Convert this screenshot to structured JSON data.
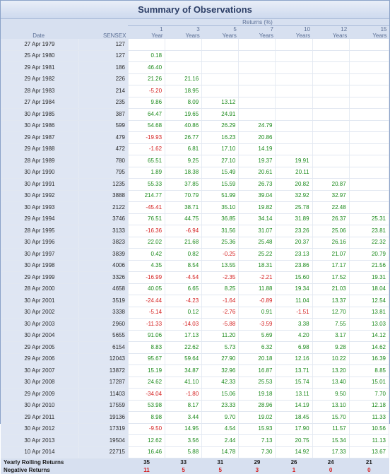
{
  "title": "Summary of Observations",
  "header": {
    "date": "Date",
    "sensex": "SENSEX",
    "returns": "Returns (%)",
    "periods": [
      {
        "n": "1",
        "unit": "Year"
      },
      {
        "n": "3",
        "unit": "Years"
      },
      {
        "n": "5",
        "unit": "Years"
      },
      {
        "n": "7",
        "unit": "Years"
      },
      {
        "n": "10",
        "unit": "Years"
      },
      {
        "n": "12",
        "unit": "Years"
      },
      {
        "n": "15",
        "unit": "Years"
      }
    ]
  },
  "colors": {
    "positive": "#1b8a1b",
    "negative": "#d41e1e"
  },
  "rows": [
    {
      "date": "27 Apr 1979",
      "sensex": "127",
      "r": [
        "",
        "",
        "",
        "",
        "",
        "",
        ""
      ]
    },
    {
      "date": "25 Apr 1980",
      "sensex": "127",
      "r": [
        "0.18",
        "",
        "",
        "",
        "",
        "",
        ""
      ]
    },
    {
      "date": "29 Apr 1981",
      "sensex": "186",
      "r": [
        "46.40",
        "",
        "",
        "",
        "",
        "",
        ""
      ]
    },
    {
      "date": "29 Apr 1982",
      "sensex": "226",
      "r": [
        "21.26",
        "21.16",
        "",
        "",
        "",
        "",
        ""
      ]
    },
    {
      "date": "28 Apr 1983",
      "sensex": "214",
      "r": [
        "-5.20",
        "18.95",
        "",
        "",
        "",
        "",
        ""
      ]
    },
    {
      "date": "27 Apr 1984",
      "sensex": "235",
      "r": [
        "9.86",
        "8.09",
        "13.12",
        "",
        "",
        "",
        ""
      ]
    },
    {
      "date": "30 Apr 1985",
      "sensex": "387",
      "r": [
        "64.47",
        "19.65",
        "24.91",
        "",
        "",
        "",
        ""
      ]
    },
    {
      "date": "30 Apr 1986",
      "sensex": "599",
      "r": [
        "54.68",
        "40.86",
        "26.29",
        "24.79",
        "",
        "",
        ""
      ]
    },
    {
      "date": "29 Apr 1987",
      "sensex": "479",
      "r": [
        "-19.93",
        "26.77",
        "16.23",
        "20.86",
        "",
        "",
        ""
      ]
    },
    {
      "date": "29 Apr 1988",
      "sensex": "472",
      "r": [
        "-1.62",
        "6.81",
        "17.10",
        "14.19",
        "",
        "",
        ""
      ]
    },
    {
      "date": "28 Apr 1989",
      "sensex": "780",
      "r": [
        "65.51",
        "9.25",
        "27.10",
        "19.37",
        "19.91",
        "",
        ""
      ]
    },
    {
      "date": "30 Apr 1990",
      "sensex": "795",
      "r": [
        "1.89",
        "18.38",
        "15.49",
        "20.61",
        "20.11",
        "",
        ""
      ]
    },
    {
      "date": "30 Apr 1991",
      "sensex": "1235",
      "r": [
        "55.33",
        "37.85",
        "15.59",
        "26.73",
        "20.82",
        "20.87",
        ""
      ]
    },
    {
      "date": "30 Apr 1992",
      "sensex": "3888",
      "r": [
        "214.77",
        "70.79",
        "51.99",
        "39.04",
        "32.92",
        "32.97",
        ""
      ]
    },
    {
      "date": "30 Apr 1993",
      "sensex": "2122",
      "r": [
        "-45.41",
        "38.71",
        "35.10",
        "19.82",
        "25.78",
        "22.48",
        ""
      ]
    },
    {
      "date": "29 Apr 1994",
      "sensex": "3746",
      "r": [
        "76.51",
        "44.75",
        "36.85",
        "34.14",
        "31.89",
        "26.37",
        "25.31"
      ]
    },
    {
      "date": "28 Apr 1995",
      "sensex": "3133",
      "r": [
        "-16.36",
        "-6.94",
        "31.56",
        "31.07",
        "23.26",
        "25.06",
        "23.81"
      ]
    },
    {
      "date": "30 Apr 1996",
      "sensex": "3823",
      "r": [
        "22.02",
        "21.68",
        "25.36",
        "25.48",
        "20.37",
        "26.16",
        "22.32"
      ]
    },
    {
      "date": "30 Apr 1997",
      "sensex": "3839",
      "r": [
        "0.42",
        "0.82",
        "-0.25",
        "25.22",
        "23.13",
        "21.07",
        "20.79"
      ]
    },
    {
      "date": "30 Apr 1998",
      "sensex": "4006",
      "r": [
        "4.35",
        "8.54",
        "13.55",
        "18.31",
        "23.86",
        "17.17",
        "21.56"
      ]
    },
    {
      "date": "29 Apr 1999",
      "sensex": "3326",
      "r": [
        "-16.99",
        "-4.54",
        "-2.35",
        "-2.21",
        "15.60",
        "17.52",
        "19.31"
      ]
    },
    {
      "date": "28 Apr 2000",
      "sensex": "4658",
      "r": [
        "40.05",
        "6.65",
        "8.25",
        "11.88",
        "19.34",
        "21.03",
        "18.04"
      ]
    },
    {
      "date": "30 Apr 2001",
      "sensex": "3519",
      "r": [
        "-24.44",
        "-4.23",
        "-1.64",
        "-0.89",
        "11.04",
        "13.37",
        "12.54"
      ]
    },
    {
      "date": "30 Apr 2002",
      "sensex": "3338",
      "r": [
        "-5.14",
        "0.12",
        "-2.76",
        "0.91",
        "-1.51",
        "12.70",
        "13.81"
      ]
    },
    {
      "date": "30 Apr 2003",
      "sensex": "2960",
      "r": [
        "-11.33",
        "-14.03",
        "-5.88",
        "-3.59",
        "3.38",
        "7.55",
        "13.03"
      ]
    },
    {
      "date": "30 Apr 2004",
      "sensex": "5655",
      "r": [
        "91.06",
        "17.13",
        "11.20",
        "5.69",
        "4.20",
        "3.17",
        "14.12"
      ]
    },
    {
      "date": "29 Apr 2005",
      "sensex": "6154",
      "r": [
        "8.83",
        "22.62",
        "5.73",
        "6.32",
        "6.98",
        "9.28",
        "14.62"
      ]
    },
    {
      "date": "29 Apr 2006",
      "sensex": "12043",
      "r": [
        "95.67",
        "59.64",
        "27.90",
        "20.18",
        "12.16",
        "10.22",
        "16.39"
      ]
    },
    {
      "date": "30 Apr 2007",
      "sensex": "13872",
      "r": [
        "15.19",
        "34.87",
        "32.96",
        "16.87",
        "13.71",
        "13.20",
        "8.85"
      ]
    },
    {
      "date": "30 Apr 2008",
      "sensex": "17287",
      "r": [
        "24.62",
        "41.10",
        "42.33",
        "25.53",
        "15.74",
        "13.40",
        "15.01"
      ]
    },
    {
      "date": "29 Apr 2009",
      "sensex": "11403",
      "r": [
        "-34.04",
        "-1.80",
        "15.06",
        "19.18",
        "13.11",
        "9.50",
        "7.70"
      ]
    },
    {
      "date": "30 Apr 2010",
      "sensex": "17559",
      "r": [
        "53.98",
        "8.17",
        "23.33",
        "28.96",
        "14.19",
        "13.10",
        "12.18"
      ]
    },
    {
      "date": "29 Apr 2011",
      "sensex": "19136",
      "r": [
        "8.98",
        "3.44",
        "9.70",
        "19.02",
        "18.45",
        "15.70",
        "11.33"
      ]
    },
    {
      "date": "30 Apr 2012",
      "sensex": "17319",
      "r": [
        "-9.50",
        "14.95",
        "4.54",
        "15.93",
        "17.90",
        "11.57",
        "10.56"
      ]
    },
    {
      "date": "30 Apr 2013",
      "sensex": "19504",
      "r": [
        "12.62",
        "3.56",
        "2.44",
        "7.13",
        "20.75",
        "15.34",
        "11.13"
      ]
    },
    {
      "date": "10 Apr 2014",
      "sensex": "22715",
      "r": [
        "16.46",
        "5.88",
        "14.78",
        "7.30",
        "14.92",
        "17.33",
        "13.67"
      ]
    }
  ],
  "summary": {
    "rolling_label": "Yearly Rolling Returns",
    "rolling": [
      "35",
      "33",
      "31",
      "29",
      "26",
      "24",
      "21"
    ],
    "negative_label": "Negative Returns",
    "negative": [
      "11",
      "5",
      "5",
      "3",
      "1",
      "0",
      "0"
    ]
  }
}
